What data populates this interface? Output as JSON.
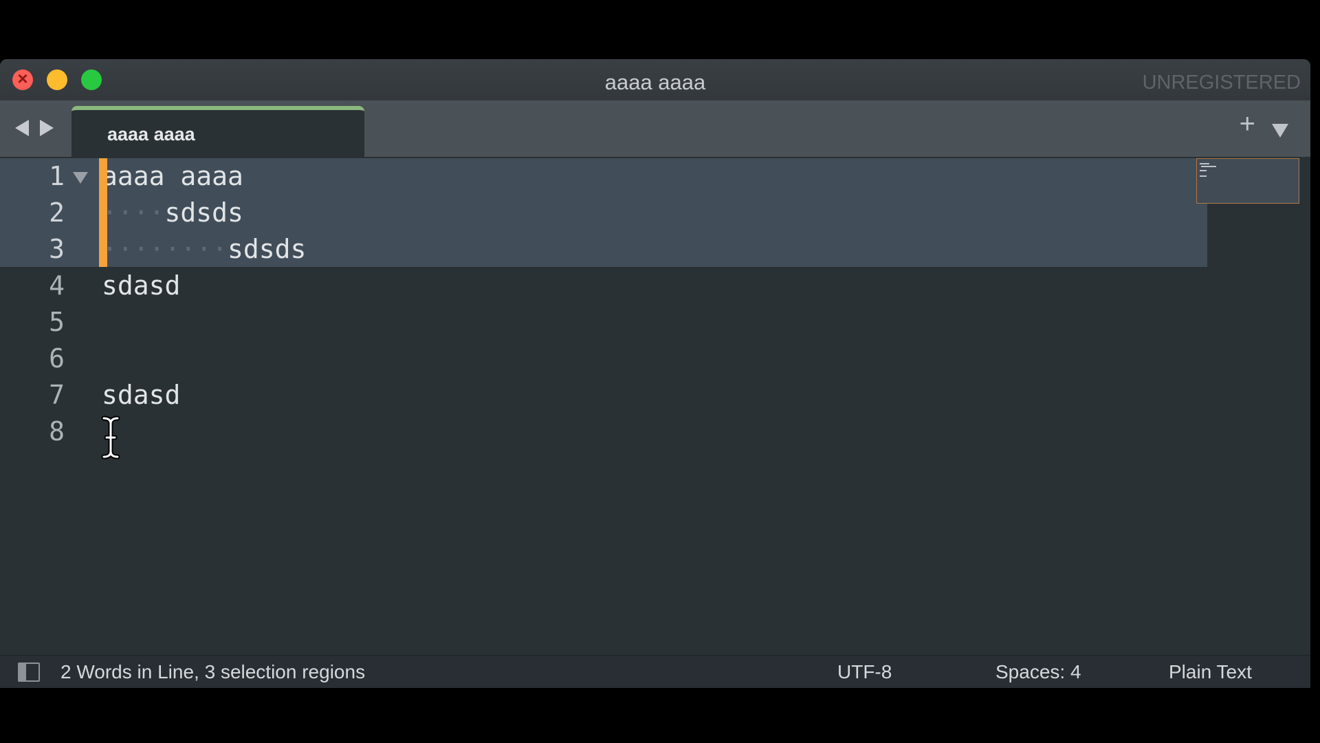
{
  "window": {
    "title": "aaaa aaaa",
    "registration": "UNREGISTERED"
  },
  "tabs": [
    {
      "label": "aaaa aaaa",
      "active": true
    }
  ],
  "editor": {
    "lines": [
      {
        "number": "1",
        "indent": "",
        "text": "aaaa aaaa",
        "selected": true,
        "foldable": true
      },
      {
        "number": "2",
        "indent": "····",
        "text": "sdsds",
        "selected": true,
        "foldable": false
      },
      {
        "number": "3",
        "indent": "········",
        "text": "sdsds",
        "selected": true,
        "foldable": false
      },
      {
        "number": "4",
        "indent": "",
        "text": "sdasd",
        "selected": false,
        "foldable": false
      },
      {
        "number": "5",
        "indent": "",
        "text": "",
        "selected": false,
        "foldable": false
      },
      {
        "number": "6",
        "indent": "",
        "text": "",
        "selected": false,
        "foldable": false
      },
      {
        "number": "7",
        "indent": "",
        "text": "sdasd",
        "selected": false,
        "foldable": false
      },
      {
        "number": "8",
        "indent": "",
        "text": "",
        "selected": false,
        "foldable": false
      }
    ]
  },
  "status": {
    "message": "2 Words in Line, 3 selection regions",
    "encoding": "UTF-8",
    "indentation": "Spaces: 4",
    "syntax": "Plain Text"
  },
  "colors": {
    "selection": "#414d59",
    "caret": "#f5a23a",
    "active_tab_indicator": "#8ab87d",
    "background": "#2a3135"
  },
  "icons": [
    "close-icon",
    "minimize-icon",
    "maximize-icon",
    "back-arrow-icon",
    "forward-arrow-icon",
    "new-tab-plus-icon",
    "tab-menu-chevron-icon",
    "fold-triangle-icon",
    "sidebar-toggle-icon",
    "text-cursor-ibeam-icon"
  ]
}
